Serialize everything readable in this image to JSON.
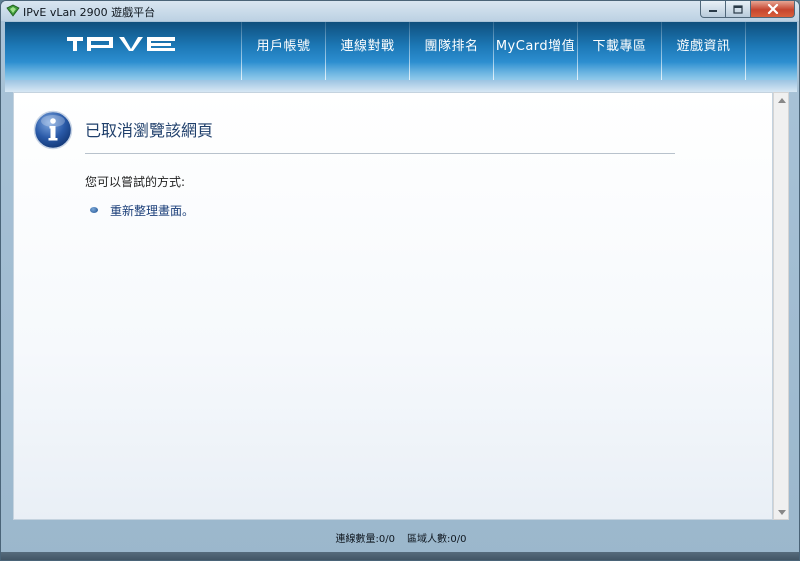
{
  "window": {
    "title": "IPvE vLan 2900 遊戲平台"
  },
  "header": {
    "logo_text": "IPVE",
    "nav": [
      {
        "label": "用戶帳號"
      },
      {
        "label": "連線對戰"
      },
      {
        "label": "團隊排名"
      },
      {
        "label": "MyCard增值"
      },
      {
        "label": "下載專區"
      },
      {
        "label": "遊戲資訊"
      }
    ]
  },
  "content": {
    "heading": "已取消瀏覽該網頁",
    "subtext": "您可以嘗試的方式:",
    "refresh_link": "重新整理畫面。"
  },
  "status": {
    "connections": "連線數量:0/0",
    "area_users": "區域人數:0/0"
  },
  "colors": {
    "header_blue": "#1c78b6",
    "link_blue": "#1c3f7a",
    "heading_blue": "#1f3f6b"
  }
}
